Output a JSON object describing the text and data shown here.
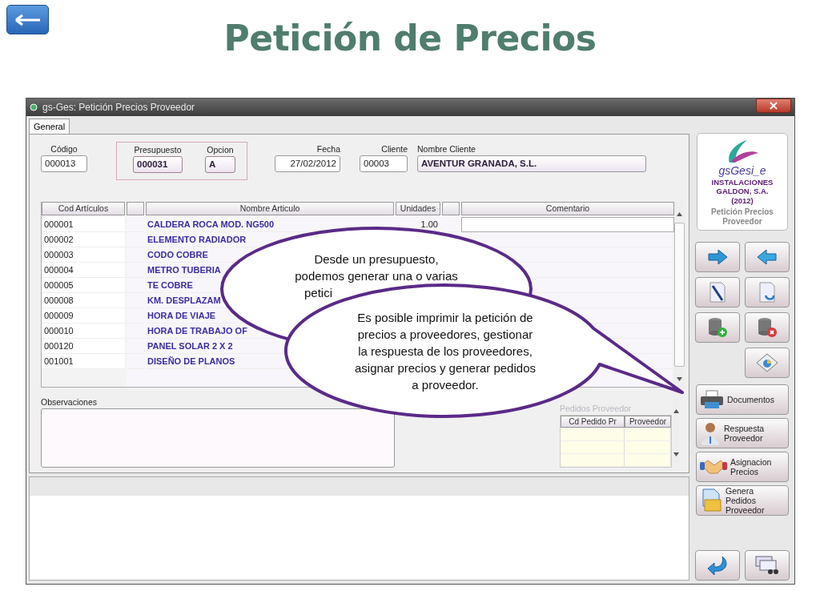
{
  "slide_title": "Petición de Precios",
  "window": {
    "title": "gs-Ges: Petición Precios Proveedor"
  },
  "tabs": [
    {
      "label": "General",
      "selected": true
    }
  ],
  "fields": [
    {
      "label": "Código",
      "value": "000013",
      "group": false
    },
    {
      "label": "Presupuesto",
      "value": "000031",
      "group": true
    },
    {
      "label": "Opcion",
      "value": "A",
      "group": true
    },
    {
      "label": "Fecha",
      "value": "27/02/2012",
      "group": false
    },
    {
      "label": "Cliente",
      "value": "00003",
      "group": false
    },
    {
      "label": "Nombre Cliente",
      "value": "AVENTUR GRANADA, S.L.",
      "group": false
    }
  ],
  "table": {
    "columns": [
      "Cod Artículos",
      "Nombre Articulo",
      "Unidades",
      "Comentario"
    ],
    "rows": [
      {
        "code": "000001",
        "name": "CALDERA ROCA MOD. NG500",
        "units": "1.00"
      },
      {
        "code": "000002",
        "name": "ELEMENTO RADIADOR"
      },
      {
        "code": "000003",
        "name": "CODO COBRE"
      },
      {
        "code": "000004",
        "name": "METRO TUBERIA"
      },
      {
        "code": "000005",
        "name": "TE COBRE"
      },
      {
        "code": "000008",
        "name": "KM. DESPLAZAM"
      },
      {
        "code": "000009",
        "name": "HORA DE VIAJE"
      },
      {
        "code": "000010",
        "name": "HORA DE TRABAJO OF"
      },
      {
        "code": "000120",
        "name": "PANEL SOLAR 2 X 2"
      },
      {
        "code": "001001",
        "name": "DISEÑO DE PLANOS"
      }
    ]
  },
  "observaciones": {
    "label": "Observaciones"
  },
  "pedidos": {
    "label": "Pedidos Proveedor",
    "columns": [
      "Cd Pedido Pr",
      "Proveedor"
    ]
  },
  "logo": {
    "name": "gsGesi_e",
    "company": "INSTALACIONES GALDON, S.A.",
    "year": "(2012)",
    "caption": "Petición Precios Proveedor"
  },
  "action_buttons": [
    "Documentos",
    "Respuesta Proveedor",
    "Asignacion Precios",
    "Genera Pedidos Proveedor"
  ],
  "callouts": [
    {
      "lines": [
        "Desde  un presupuesto,",
        "podemos generar una o varias",
        "petici"
      ]
    },
    {
      "lines": [
        "Es posible imprimir la petición de",
        "precios a proveedores, gestionar",
        "la respuesta de los proveedores,",
        "asignar precios y generar pedidos",
        "a proveedor."
      ]
    }
  ]
}
